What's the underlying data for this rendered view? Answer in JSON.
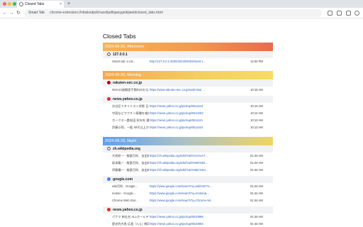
{
  "browser": {
    "tab_title": "Closed Tabs",
    "tab_close": "×",
    "new_tab": "+",
    "back": "←",
    "forward": "→",
    "reload": "↻",
    "chip": "Smart Tab",
    "url": "chrome-extension://nbiskedpdchaoclipdfsjaeygmkjiaeldclosed_tabs.html",
    "colors": {
      "close": "#ff5f57",
      "minimize": "#febc2e",
      "zoom": "#28c840"
    }
  },
  "page": {
    "title": "Closed Tabs",
    "groups": [
      {
        "label": "2024-09-30, Afternoon",
        "theme": "afternoon",
        "sites": [
          {
            "name": "127.0.0.1",
            "icon": "globe-icon",
            "rows": [
              {
                "title": "Smart tab: a col...",
                "url": "http://127.0.0.1:4000/2024/09/30/smart-t...",
                "time": "12:04 PM"
              }
            ]
          }
        ]
      },
      {
        "label": "2024-09-30, Morning",
        "theme": "morning",
        "sites": [
          {
            "name": "rakuten-sec.co.jp",
            "icon": "rakuten-icon",
            "rows": [
              {
                "title": "NISA口座開設手数料のおなじ...",
                "url": "https://www.rakuten-sec.co.jp/web/nisa/...",
                "time": "10:15 AM"
              }
            ]
          },
          {
            "name": "news.yahoo.co.jp",
            "icon": "yahoo-icon",
            "rows": [
              {
                "title": "渋谷区でタイミスト状態 日本代...",
                "url": "https://news.yahoo.co.jp/pickup/6511153",
                "time": "10:14 AM"
              },
              {
                "title": "中国などワクチン接種を検討 健康...",
                "url": "https://news.yahoo.co.jp/pickup/6510292",
                "time": "10:14 AM"
              },
              {
                "title": "ホークス一塁松田 秋年先 選手...",
                "url": "https://news.yahoo.co.jp/pickup/6511121",
                "time": "10:13 AM"
              },
              {
                "title": "伊藤沙莉、一般 40代以上から...",
                "url": "https://news.yahoo.co.jp/pickup/6511163",
                "time": "10:13 AM"
              }
            ]
          }
        ]
      },
      {
        "label": "2024-09-29, Night",
        "theme": "night",
        "sites": [
          {
            "name": "zh.wikipedia.org",
            "icon": "wikipedia-icon",
            "rows": [
              {
                "title": "大前研一 - 維基百科、自由的...",
                "url": "https://zh.wikipedia.org/wiki/%E5%A4%A7...",
                "time": "01:44 AM"
              },
              {
                "title": "坂本龍一 - 維基百科、自由的...",
                "url": "https://zh.wikipedia.org/wiki/%E5%9D%82...",
                "time": "01:44 AM"
              },
              {
                "title": "伊藤穰一 - 維基百科、自由的...",
                "url": "https://zh.wikipedia.org/wiki/%E4%BC%8A...",
                "time": "01:44 AM"
              }
            ]
          },
          {
            "name": "google.com",
            "icon": "google-icon",
            "rows": [
              {
                "title": "wiki百科 - Google...",
                "url": "https://www.google.com/search?q=wiki%E7%...",
                "time": "01:44 AM"
              },
              {
                "title": "motion - Google...",
                "url": "https://www.google.com/search?q=motion&...",
                "time": "01:44 AM"
              },
              {
                "title": "Chrome Web Stor...",
                "url": "https://www.google.com/search?q=Chrome+W...",
                "time": "01:44 AM"
              }
            ]
          },
          {
            "name": "news.yahoo.co.jp",
            "icon": "yahoo-icon",
            "rows": [
              {
                "title": "パナマ 新社名 ALLホールディ...",
                "url": "https://news.yahoo.co.jp/pickup/6510998",
                "time": "01:44 AM"
              },
              {
                "title": "歴史的大差 広島 ついに 戦局以...",
                "url": "https://news.yahoo.co.jp/pickup/6510994",
                "time": "01:44 AM"
              }
            ]
          }
        ]
      }
    ]
  }
}
